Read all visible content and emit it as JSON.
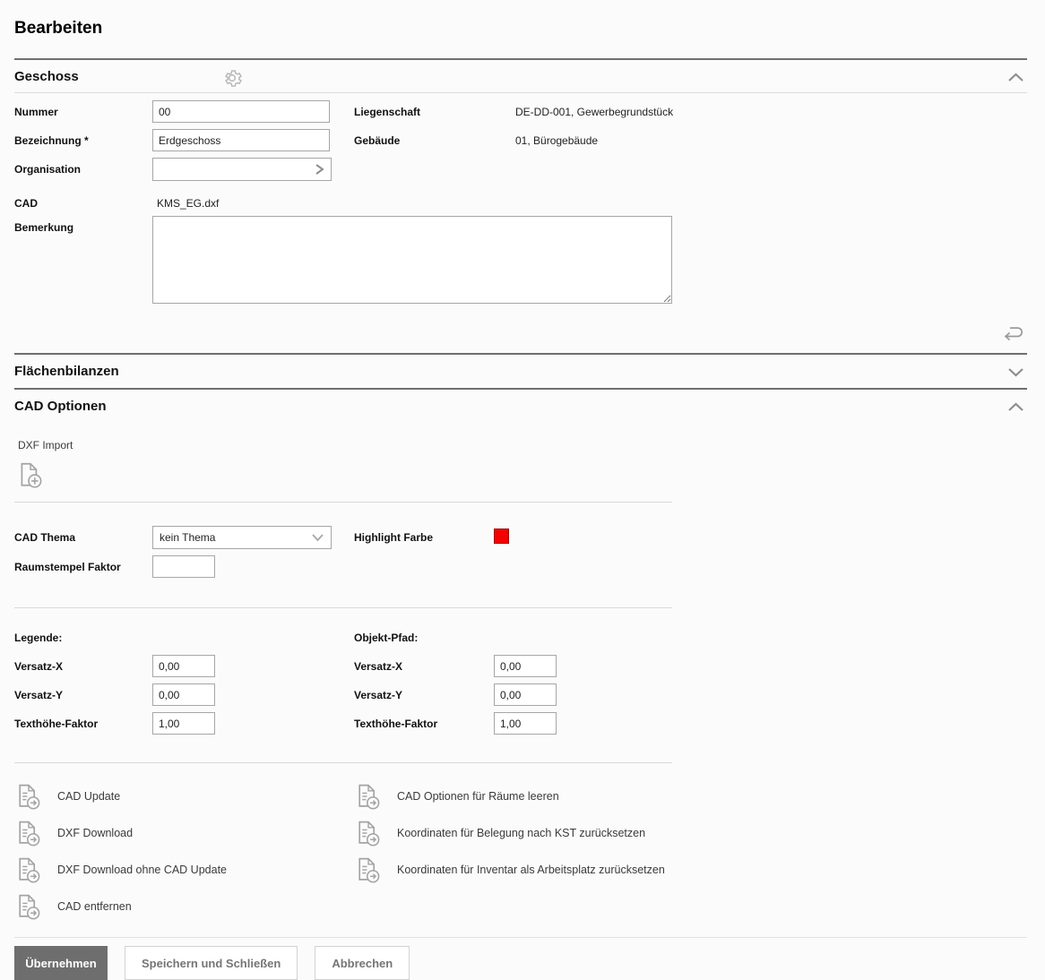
{
  "page": {
    "title": "Bearbeiten"
  },
  "colors": {
    "section_border": "#6f6f6f",
    "highlight_farbe": "#f40000",
    "primary_button_bg": "#6e6e6e"
  },
  "geschoss": {
    "title": "Geschoss",
    "fields": {
      "nummer_label": "Nummer",
      "nummer_value": "00",
      "bezeichnung_label": "Bezeichnung *",
      "bezeichnung_value": "Erdgeschoss",
      "organisation_label": "Organisation",
      "cad_label": "CAD",
      "cad_value": "KMS_EG.dxf",
      "bemerkung_label": "Bemerkung",
      "bemerkung_value": "",
      "liegenschaft_label": "Liegenschaft",
      "liegenschaft_value": "DE-DD-001, Gewerbegrundstück",
      "gebaeude_label": "Gebäude",
      "gebaeude_value": "01, Bürogebäude"
    }
  },
  "flaechenbilanzen": {
    "title": "Flächenbilanzen"
  },
  "cad_optionen": {
    "title": "CAD Optionen",
    "dxf_import_label": "DXF Import",
    "cad_thema_label": "CAD Thema",
    "cad_thema_value": "kein Thema",
    "highlight_farbe_label": "Highlight Farbe",
    "raumstempel_label": "Raumstempel Faktor",
    "raumstempel_value": "",
    "legende": {
      "title": "Legende:",
      "versatz_x_label": "Versatz-X",
      "versatz_x_value": "0,00",
      "versatz_y_label": "Versatz-Y",
      "versatz_y_value": "0,00",
      "texthoehe_label": "Texthöhe-Faktor",
      "texthoehe_value": "1,00"
    },
    "objekt_pfad": {
      "title": "Objekt-Pfad:",
      "versatz_x_label": "Versatz-X",
      "versatz_x_value": "0,00",
      "versatz_y_label": "Versatz-Y",
      "versatz_y_value": "0,00",
      "texthoehe_label": "Texthöhe-Faktor",
      "texthoehe_value": "1,00"
    },
    "actions_left": [
      "CAD Update",
      "DXF Download",
      "DXF Download ohne CAD Update",
      "CAD entfernen"
    ],
    "actions_right": [
      "CAD Optionen für Räume leeren",
      "Koordinaten für Belegung nach KST zurücksetzen",
      "Koordinaten für Inventar als Arbeitsplatz zurücksetzen"
    ]
  },
  "footer": {
    "uebernehmen": "Übernehmen",
    "speichern_und_schliessen": "Speichern und Schließen",
    "abbrechen": "Abbrechen"
  },
  "icons": [
    "gear-icon",
    "chevron-up-icon",
    "chevron-down-icon",
    "undo-icon",
    "dxf-import-icon",
    "document-action-icon",
    "chevron-right-icon",
    "select-chevron-icon",
    "color-swatch"
  ]
}
